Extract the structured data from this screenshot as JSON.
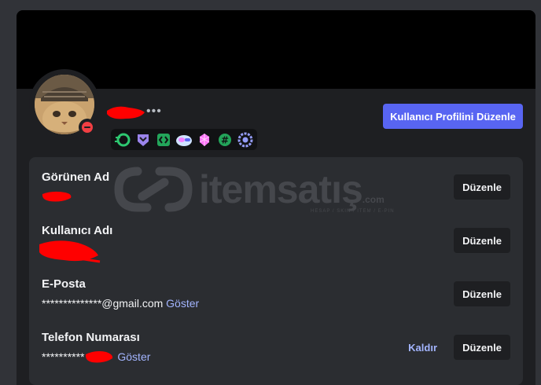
{
  "profile": {
    "more_dots": "•••",
    "edit_profile_label": "Kullanıcı Profilini Düzenle",
    "status": "do-not-disturb",
    "badges": [
      {
        "icon": "nitro-badge-icon",
        "color": "#2dc770"
      },
      {
        "icon": "hypesquad-badge-icon",
        "color": "#9b84ec"
      },
      {
        "icon": "active-developer-badge-icon",
        "color": "#23a55a"
      },
      {
        "icon": "nitro-subscriber-badge-icon",
        "color": "#f47fff"
      },
      {
        "icon": "server-booster-badge-icon",
        "color": "#ff73fa"
      },
      {
        "icon": "completed-quest-badge-icon",
        "color": "#23a55a"
      },
      {
        "icon": "early-supporter-badge-icon",
        "color": "#949cf7"
      }
    ]
  },
  "fields": {
    "display_name": {
      "label": "Görünen Ad",
      "edit_label": "Düzenle"
    },
    "username": {
      "label": "Kullanıcı Adı",
      "edit_label": "Düzenle"
    },
    "email": {
      "label": "E-Posta",
      "value": "**************@gmail.com",
      "reveal_label": "Göster",
      "edit_label": "Düzenle"
    },
    "phone": {
      "label": "Telefon Numarası",
      "value": "**********",
      "reveal_label": "Göster",
      "remove_label": "Kaldır",
      "edit_label": "Düzenle"
    }
  },
  "watermark": {
    "text": "itemsatış",
    "domain": ".com",
    "tagline": "HESAP / SKIN / ITEM / E-PIN"
  },
  "colors": {
    "accent": "#5865f2",
    "link": "#a3b5ff",
    "dnd": "#f23f43",
    "redaction": "#ff0000"
  }
}
